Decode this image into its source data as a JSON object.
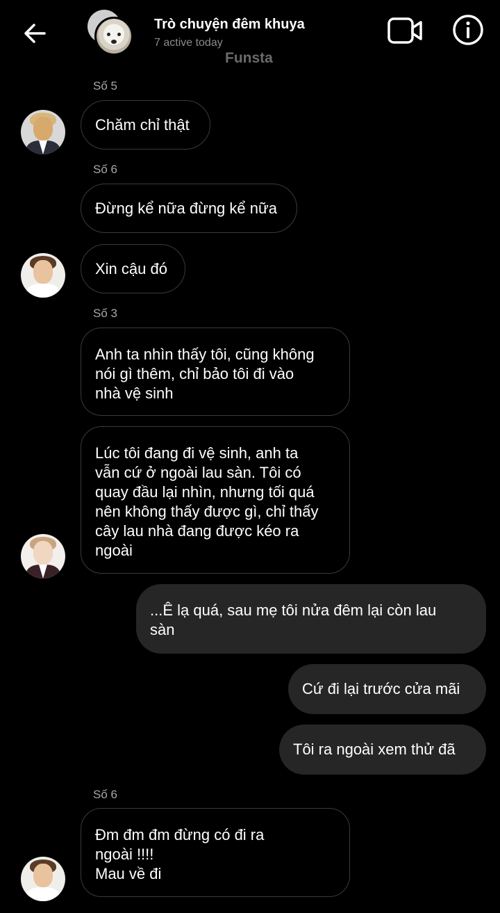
{
  "header": {
    "title": "Trò chuyện đêm khuya",
    "subtitle": "7 active today",
    "watermark": "Funsta"
  },
  "messages": [
    {
      "sender": "Số 5",
      "text": "Chăm chỉ thật",
      "direction": "incoming"
    },
    {
      "sender": "Số 6",
      "text": "Đừng kể nữa đừng kể nữa",
      "direction": "incoming"
    },
    {
      "text": "Xin cậu đó",
      "direction": "incoming"
    },
    {
      "sender": "Số 3",
      "text": "Anh ta nhìn thấy tôi, cũng không\nnói gì thêm, chỉ bảo tôi đi vào\nnhà vệ sinh",
      "direction": "incoming"
    },
    {
      "text": "Lúc tôi đang đi vệ sinh, anh ta\nvẫn cứ ở ngoài lau sàn. Tôi có\nquay đầu lại nhìn, nhưng tối quá\nnên không thấy được gì, chỉ thấy\ncây lau nhà đang được kéo ra\nngoài",
      "direction": "incoming"
    },
    {
      "text": "...Ê lạ quá, sau mẹ tôi nửa đêm lại còn lau\nsàn",
      "direction": "outgoing"
    },
    {
      "text": "Cứ đi lại trước cửa mãi",
      "direction": "outgoing"
    },
    {
      "text": "Tôi ra ngoài xem thử đã",
      "direction": "outgoing"
    },
    {
      "sender": "Số 6",
      "text": "Đm đm đm đừng có đi ra\nngoài !!!!\nMau về đi",
      "direction": "incoming"
    }
  ],
  "colors": {
    "background": "#000000",
    "incoming_border": "#3a3a3a",
    "outgoing_bubble": "#262626",
    "secondary_text": "#a8a8a8"
  },
  "icons": {
    "back": "arrow-left-icon",
    "video": "video-camera-icon",
    "info": "info-icon"
  }
}
